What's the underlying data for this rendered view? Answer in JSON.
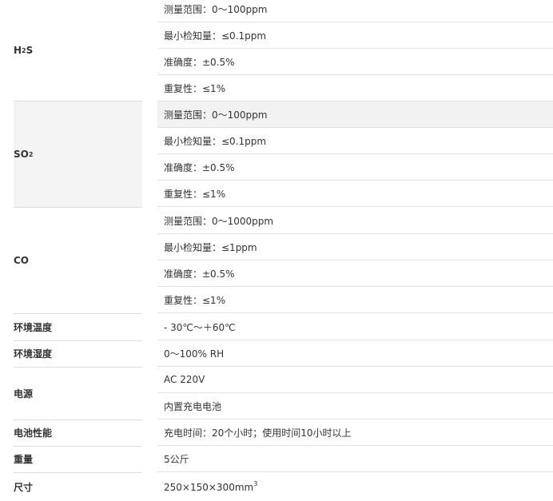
{
  "groups": [
    {
      "label_main": "H",
      "label_sub": "2",
      "label_tail": "S",
      "items": [
        "测量范围：0～100ppm",
        "最小检知量：≤0.1ppm",
        "准确度：±0.5%",
        "重复性：≤1%"
      ]
    },
    {
      "label_main": "SO",
      "label_sub": "2",
      "label_tail": "",
      "items": [
        "测量范围：0～100ppm",
        "最小检知量：≤0.1ppm",
        "准确度：±0.5%",
        "重复性：≤1%"
      ]
    },
    {
      "label_main": "CO",
      "label_sub": "",
      "label_tail": "",
      "items": [
        "测量范围：0～1000ppm",
        "最小检知量：≤1ppm",
        "准确度：±0.5%",
        "重复性：≤1%"
      ]
    }
  ],
  "env_temp": {
    "label": "环境温度",
    "value": "- 30℃～＋60℃"
  },
  "env_humidity": {
    "label": "环境湿度",
    "value": "0～100% RH"
  },
  "power": {
    "label": "电源",
    "items": [
      "AC 220V",
      "内置充电电池"
    ]
  },
  "battery": {
    "label": "电池性能",
    "value": "充电时间：20个小时；使用时间10小时以上"
  },
  "weight": {
    "label": "重量",
    "value": "5公斤"
  },
  "size": {
    "label": "尺寸",
    "value": "250×150×300mm",
    "value_sup": "3"
  }
}
